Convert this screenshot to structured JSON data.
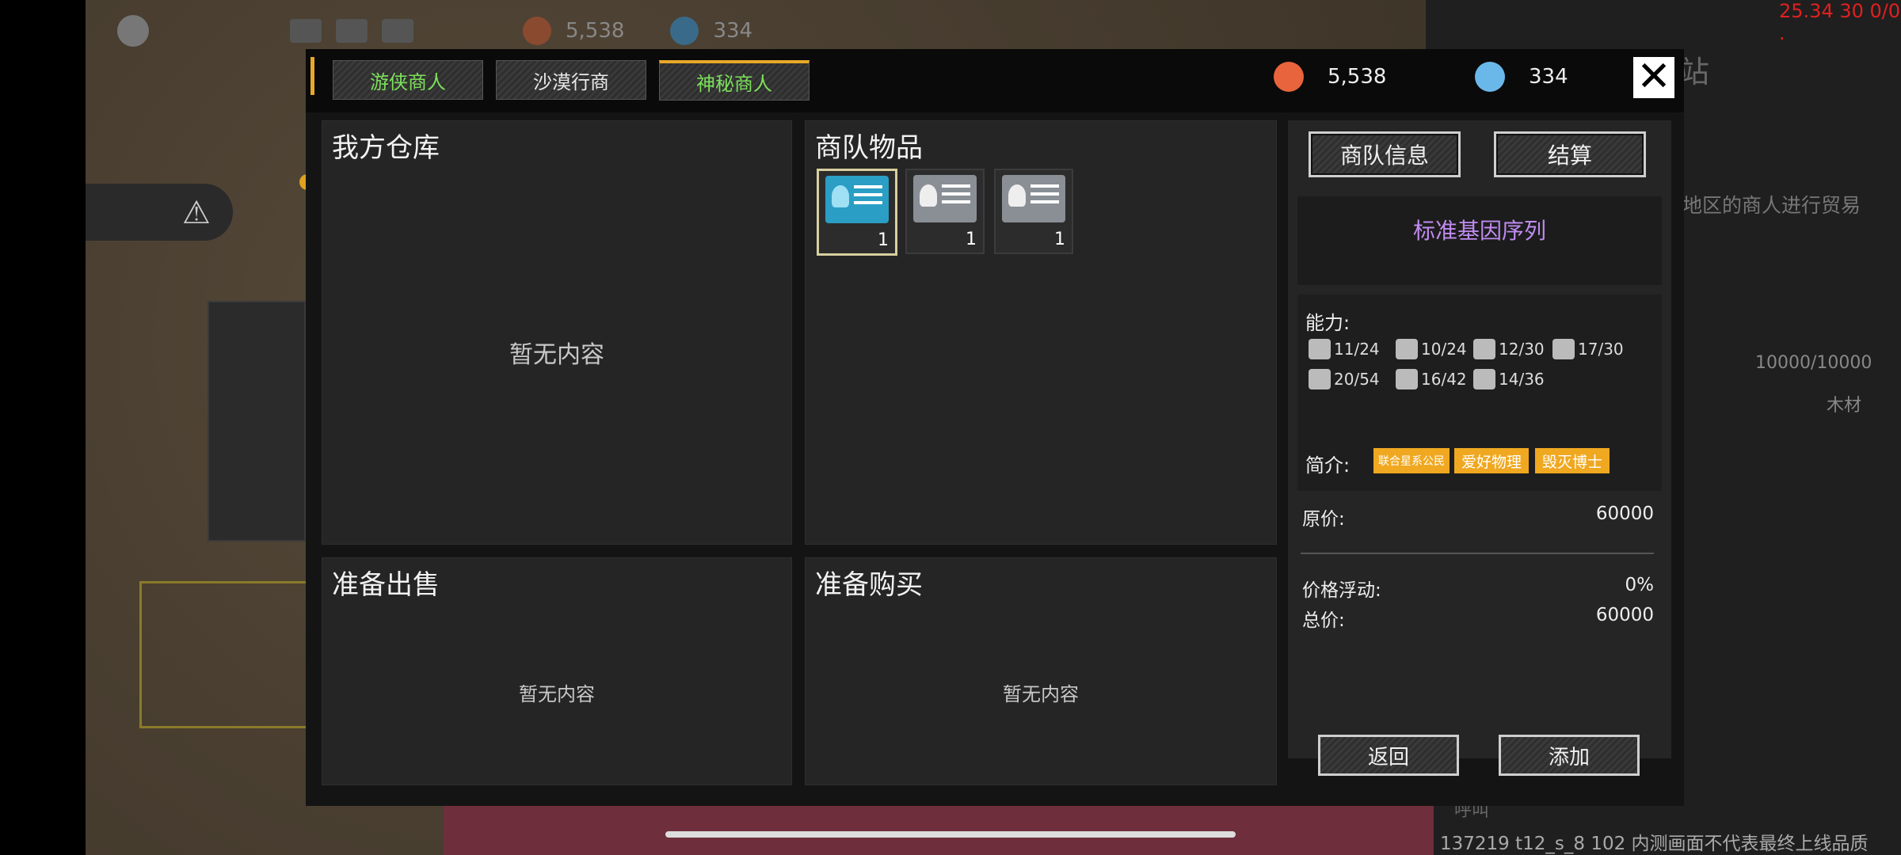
{
  "hud": {
    "resource1_value": "5,538",
    "resource2_value": "334"
  },
  "background": {
    "station_title": "站",
    "trade_hint": "地区的商人进行贸易",
    "capacity": "10000/10000",
    "material": "木材",
    "call_label": "呼叫",
    "fps_readout": "25.34 30 0/0 .",
    "build_note": "137219 t12_s_8 102  内测画面不代表最终上线品质"
  },
  "tabs": [
    {
      "label": "游侠商人",
      "active": false,
      "color": "#7be05a"
    },
    {
      "label": "沙漠行商",
      "active": false,
      "color": "#e8e8e8"
    },
    {
      "label": "神秘商人",
      "active": true,
      "color": "#7be05a"
    }
  ],
  "resources": {
    "gold_value": "5,538",
    "gold_color": "#e8643c",
    "gem_value": "334",
    "gem_color": "#6ab8ea"
  },
  "panels": {
    "warehouse_title": "我方仓库",
    "warehouse_empty": "暂无内容",
    "caravan_title": "商队物品",
    "sell_title": "准备出售",
    "sell_empty": "暂无内容",
    "buy_title": "准备购买",
    "buy_empty": "暂无内容"
  },
  "caravan_items": [
    {
      "icon": "gene-card-icon",
      "count": "1",
      "selected": true
    },
    {
      "icon": "person-card-icon",
      "count": "1",
      "selected": false
    },
    {
      "icon": "person-card-icon",
      "count": "1",
      "selected": false
    }
  ],
  "info": {
    "caravan_info_button": "商队信息",
    "checkout_button": "结算",
    "item_name": "标准基因序列",
    "ability_label": "能力:",
    "stats": [
      {
        "icon": "arm-icon",
        "value": "11/24"
      },
      {
        "icon": "book-icon",
        "value": "10/24"
      },
      {
        "icon": "paw-icon",
        "value": "12/30"
      },
      {
        "icon": "tools-icon",
        "value": "17/30"
      },
      {
        "icon": "leaf-icon",
        "value": "20/54"
      },
      {
        "icon": "head-icon",
        "value": "16/42"
      },
      {
        "icon": "target-icon",
        "value": "14/36"
      }
    ],
    "intro_label": "简介:",
    "tags": [
      "联合星系公民",
      "爱好物理",
      "毁灭博士"
    ],
    "original_price_label": "原价:",
    "original_price": "60000",
    "fluctuation_label": "价格浮动:",
    "fluctuation": "0%",
    "total_label": "总价:",
    "total": "60000"
  },
  "actions": {
    "back_button": "返回",
    "add_button": "添加"
  }
}
